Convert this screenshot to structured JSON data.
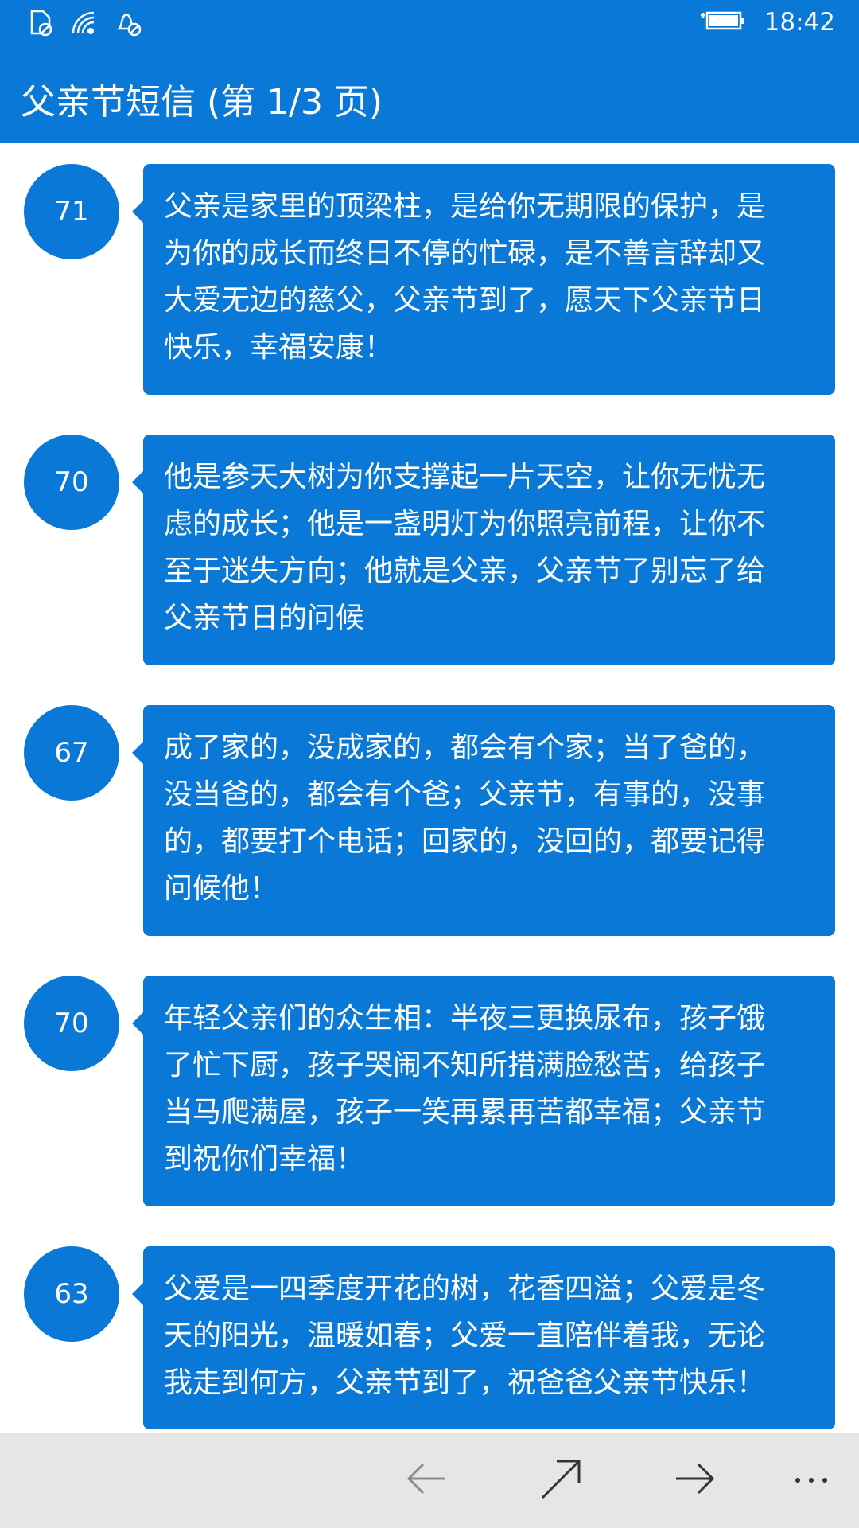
{
  "status_bar": {
    "time": "18:42",
    "icons": [
      "sim-icon",
      "wifi-icon",
      "notification-icon",
      "battery-icon"
    ]
  },
  "header": {
    "title": "父亲节短信 (第 1/3 页)"
  },
  "messages": [
    {
      "count": "71",
      "text": "父亲是家里的顶梁柱，是给你无期限的保护，是为你的成长而终日不停的忙碌，是不善言辞却又大爱无边的慈父，父亲节到了，愿天下父亲节日快乐，幸福安康！"
    },
    {
      "count": "70",
      "text": "他是参天大树为你支撑起一片天空，让你无忧无虑的成长；他是一盏明灯为你照亮前程，让你不至于迷失方向；他就是父亲，父亲节了别忘了给父亲节日的问候"
    },
    {
      "count": "67",
      "text": "成了家的，没成家的，都会有个家；当了爸的，没当爸的，都会有个爸；父亲节，有事的，没事的，都要打个电话；回家的，没回的，都要记得问候他！"
    },
    {
      "count": "70",
      "text": "年轻父亲们的众生相：半夜三更换尿布，孩子饿了忙下厨，孩子哭闹不知所措满脸愁苦，给孩子当马爬满屋，孩子一笑再累再苦都幸福；父亲节到祝你们幸福！"
    },
    {
      "count": "63",
      "text": "父爱是一四季度开花的树，花香四溢；父爱是冬天的阳光，温暖如春；父爱一直陪伴着我，无论我走到何方，父亲节到了，祝爸爸父亲节快乐！"
    }
  ],
  "app_bar": {
    "buttons": [
      "back-arrow-icon",
      "share-icon",
      "forward-arrow-icon",
      "more-icon"
    ]
  },
  "colors": {
    "accent": "#0a78d7",
    "app_bar_bg": "#e6e6e6",
    "icon": "#333333"
  }
}
